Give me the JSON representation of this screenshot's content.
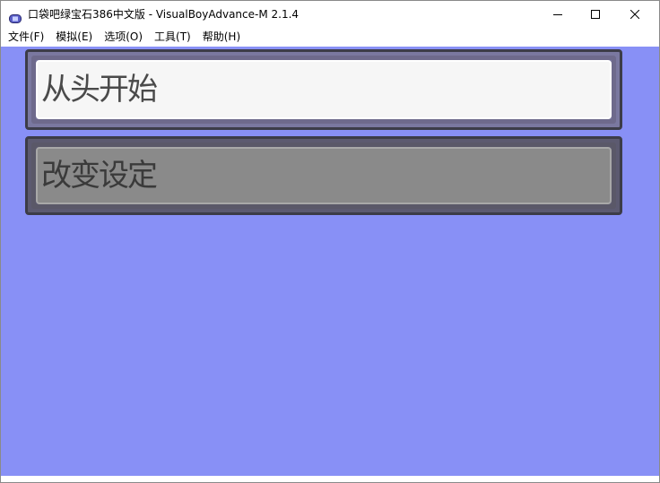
{
  "window": {
    "title": "口袋吧绿宝石386中文版 - VisualBoyAdvance-M 2.1.4"
  },
  "menu": {
    "items": [
      {
        "label": "文件(F)"
      },
      {
        "label": "模拟(E)"
      },
      {
        "label": "选项(O)"
      },
      {
        "label": "工具(T)"
      },
      {
        "label": "帮助(H)"
      }
    ]
  },
  "game": {
    "options": [
      {
        "label": "从头开始",
        "selected": true
      },
      {
        "label": "改变设定",
        "selected": false
      }
    ],
    "colors": {
      "background": "#8890f6",
      "selected_fill": "#f6f6f6",
      "unselected_fill": "#8a8a8a",
      "border": "#3c3c48"
    }
  },
  "icons": {
    "app": "gameboy-advance-icon",
    "minimize": "minimize-icon",
    "maximize": "maximize-icon",
    "close": "close-icon"
  }
}
